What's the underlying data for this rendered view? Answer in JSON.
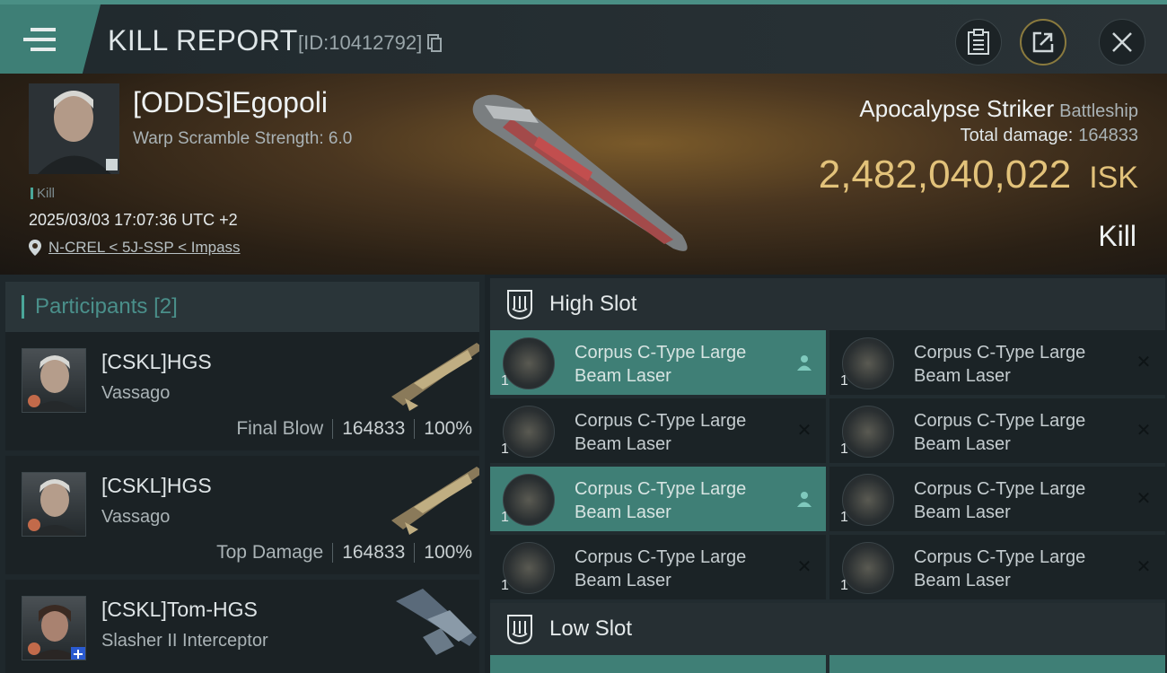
{
  "header": {
    "title": "KILL REPORT",
    "kill_id": "[ID:10412792]"
  },
  "victim": {
    "name": "[ODDS]Egopoli",
    "warp_scramble": "Warp Scramble Strength: 6.0",
    "tag": "Kill",
    "datetime": "2025/03/03 17:07:36 UTC +2",
    "location": "N-CREL < 5J-SSP < Impass"
  },
  "ship": {
    "name": "Apocalypse Striker",
    "class": "Battleship",
    "damage_label": "Total damage:",
    "damage_value": "164833",
    "isk_value": "2,482,040,022",
    "isk_unit": "ISK",
    "result": "Kill"
  },
  "participants": {
    "label": "Participants",
    "count": "[2]",
    "rows": [
      {
        "name": "[CSKL]HGS",
        "ship": "Vassago",
        "role": "Final Blow",
        "damage": "164833",
        "pct": "100%"
      },
      {
        "name": "[CSKL]HGS",
        "ship": "Vassago",
        "role": "Top Damage",
        "damage": "164833",
        "pct": "100%"
      },
      {
        "name": "[CSKL]Tom-HGS",
        "ship": "Slasher II Interceptor"
      }
    ]
  },
  "slots": {
    "high_label": "High Slot",
    "low_label": "Low Slot",
    "modules": [
      {
        "name": "Corpus C-Type Large Beam Laser",
        "qty": "1",
        "status": "dropped"
      },
      {
        "name": "Corpus C-Type Large Beam Laser",
        "qty": "1",
        "status": "destroyed"
      },
      {
        "name": "Corpus C-Type Large Beam Laser",
        "qty": "1",
        "status": "destroyed"
      },
      {
        "name": "Corpus C-Type Large Beam Laser",
        "qty": "1",
        "status": "destroyed"
      },
      {
        "name": "Corpus C-Type Large Beam Laser",
        "qty": "1",
        "status": "dropped"
      },
      {
        "name": "Corpus C-Type Large Beam Laser",
        "qty": "1",
        "status": "destroyed"
      },
      {
        "name": "Corpus C-Type Large Beam Laser",
        "qty": "1",
        "status": "destroyed"
      },
      {
        "name": "Corpus C-Type Large Beam Laser",
        "qty": "1",
        "status": "destroyed"
      }
    ]
  },
  "colors": {
    "accent": "#3f7f76",
    "isk": "#e2c27a"
  }
}
